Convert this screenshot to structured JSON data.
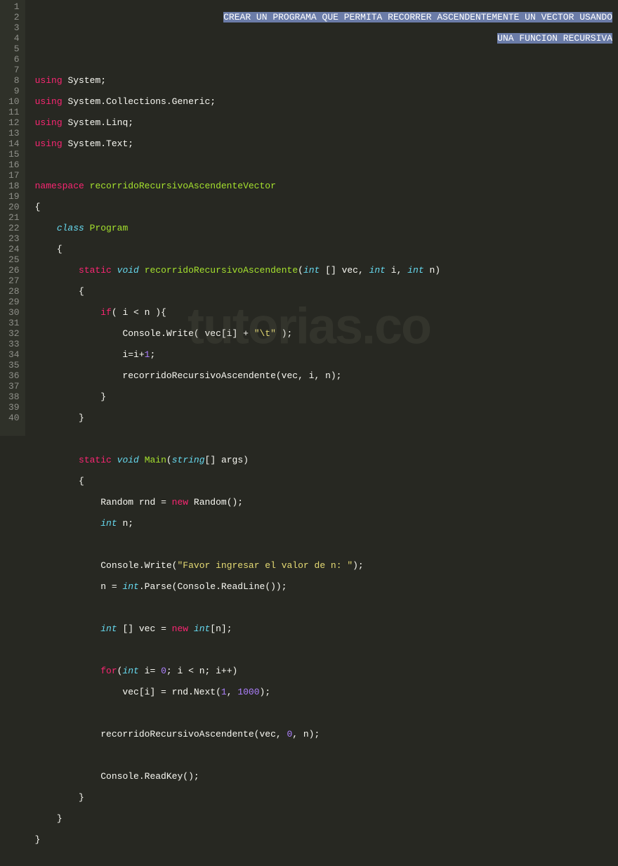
{
  "watermark": "tutorias.co",
  "gutter": {
    "start": 1,
    "end": 40
  },
  "comment": {
    "line1": "CREAR UN PROGRAMA QUE PERMITA RECORRER ASCENDENTEMENTE UN VECTOR USANDO",
    "line2": "UNA FUNCION RECURSIVA"
  },
  "code": {
    "using": "using",
    "system": "System",
    "collections": "System.Collections.Generic",
    "linq": "System.Linq",
    "text": "System.Text",
    "namespace_kw": "namespace",
    "namespace_name": "recorridoRecursivoAscendenteVector",
    "class_kw": "class",
    "class_name": "Program",
    "static_kw": "static",
    "void_kw": "void",
    "fn1": "recorridoRecursivoAscendente",
    "int_kw": "int",
    "param_vec": "vec",
    "param_i": "i",
    "param_n": "n",
    "if_kw": "if",
    "console": "Console",
    "write": "Write",
    "tab_str": "\"\\t\"",
    "plus1": "1",
    "main_fn": "Main",
    "string_kw": "string",
    "args": "args",
    "random": "Random",
    "rnd": "rnd",
    "new_kw": "new",
    "n_var": "n",
    "prompt_str": "\"Favor ingresar el valor de n: \"",
    "parse": "Parse",
    "readline": "ReadLine",
    "vec_var": "vec",
    "for_kw": "for",
    "zero": "0",
    "next": "Next",
    "one": "1",
    "thousand": "1000",
    "readkey": "ReadKey"
  }
}
